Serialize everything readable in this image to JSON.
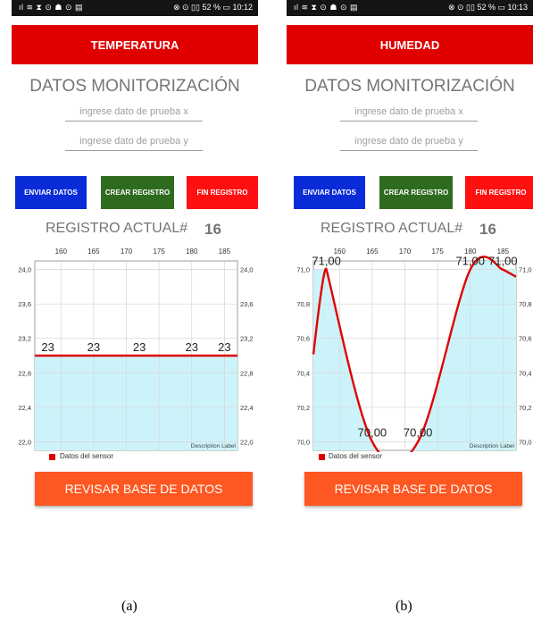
{
  "screens": [
    {
      "status": {
        "left": "ıl ≋ ⧗ ⊙ ☗ ⊙ ▤",
        "right": "⊗ ⊙ ▯▯ 52 % ▭ 10:12"
      },
      "app_title": "TEMPERATURA",
      "heading": "DATOS MONITORIZACIÓN",
      "input_x_placeholder": "ingrese dato de prueba x",
      "input_y_placeholder": "ingrese dato de prueba y",
      "buttons": {
        "enviar": "ENVIAR DATOS",
        "crear": "CREAR REGISTRO",
        "fin": "FIN REGISTRO"
      },
      "registro_label": "REGISTRO ACTUAL#",
      "registro_value": "16",
      "description_label": "Description Label",
      "legend_label": "Datos del sensor",
      "review_button": "REVISAR BASE DE DATOS",
      "caption": "(a)"
    },
    {
      "status": {
        "left": "ıl ≋ ⧗ ⊙ ☗ ⊙ ▤",
        "right": "⊗ ⊙ ▯▯ 52 % ▭ 10:13"
      },
      "app_title": "HUMEDAD",
      "heading": "DATOS MONITORIZACIÓN",
      "input_x_placeholder": "ingrese dato de prueba x",
      "input_y_placeholder": "ingrese dato de prueba y",
      "buttons": {
        "enviar": "ENVIAR DATOS",
        "crear": "CREAR REGISTRO",
        "fin": "FIN REGISTRO"
      },
      "registro_label": "REGISTRO ACTUAL#",
      "registro_value": "16",
      "description_label": "Description Label",
      "legend_label": "Datos del sensor",
      "review_button": "REVISAR BASE DE DATOS",
      "caption": "(b)"
    }
  ],
  "colors": {
    "app_bar": "#e00000",
    "enviar": "#0a2bd8",
    "crear": "#2f6b1f",
    "fin": "#ff1010",
    "review": "#ff5722",
    "line": "#e00000",
    "fill": "#cdf3fa"
  },
  "chart_data": [
    {
      "type": "area",
      "series": [
        {
          "name": "Datos del sensor",
          "x": [
            158,
            165,
            172,
            180,
            185
          ],
          "y": [
            23,
            23,
            23,
            23,
            23
          ]
        }
      ],
      "point_labels": [
        "23",
        "23",
        "23",
        "23",
        "23"
      ],
      "xticks": [
        "160",
        "165",
        "170",
        "175",
        "180",
        "185"
      ],
      "yticks": [
        "24,0",
        "23,6",
        "23,2",
        "22,8",
        "22,4",
        "22,0"
      ],
      "xlim": [
        156,
        187
      ],
      "ylim": [
        21.9,
        24.1
      ],
      "grid": true,
      "legend": "bottom-left"
    },
    {
      "type": "area",
      "series": [
        {
          "name": "Datos del sensor",
          "x": [
            158,
            165,
            172,
            180,
            185
          ],
          "y": [
            71,
            70,
            70,
            71,
            71
          ]
        }
      ],
      "point_labels": [
        "71,00",
        "70,00",
        "70,00",
        "71,00",
        "71,00"
      ],
      "xticks": [
        "160",
        "165",
        "170",
        "175",
        "180",
        "185"
      ],
      "yticks": [
        "71,0",
        "70,8",
        "70,6",
        "70,4",
        "70,2",
        "70,0"
      ],
      "xlim": [
        156,
        187
      ],
      "ylim": [
        69.95,
        71.05
      ],
      "grid": true,
      "legend": "bottom-left"
    }
  ]
}
